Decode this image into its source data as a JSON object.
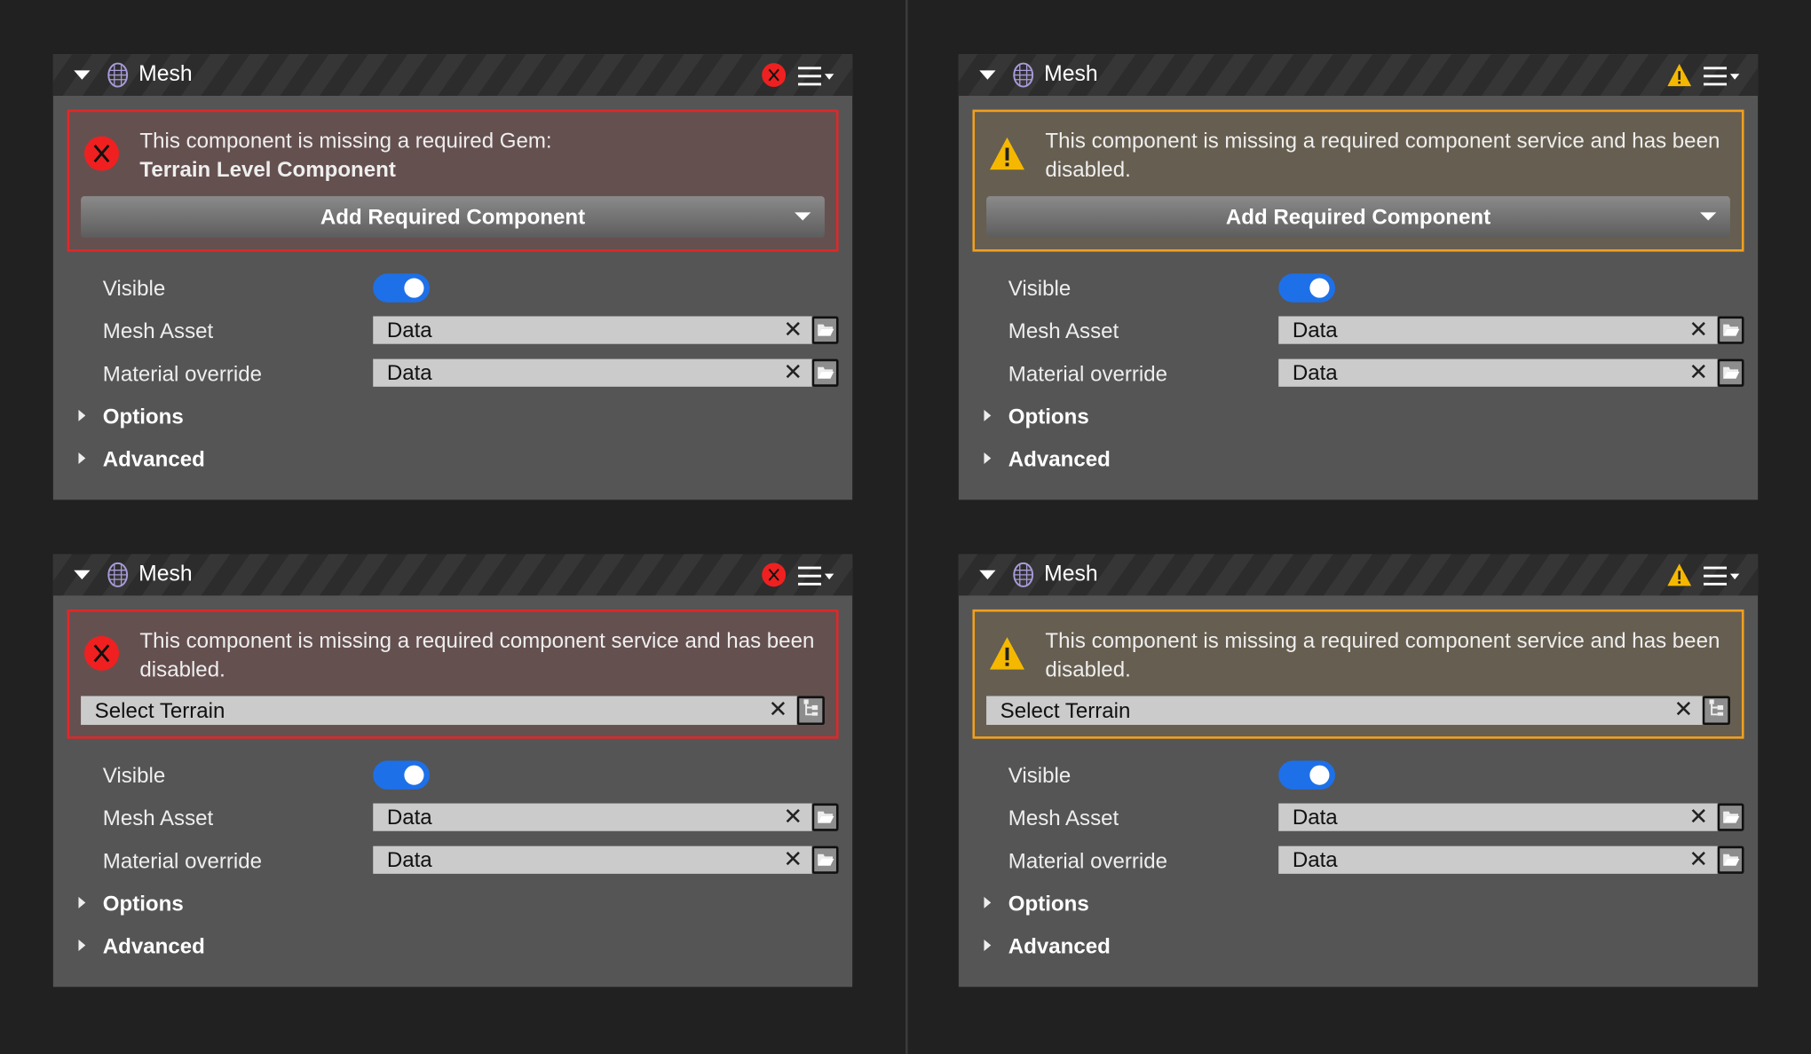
{
  "panels": [
    {
      "title": "Mesh",
      "severity": "error",
      "message": "This component is missing a required Gem:",
      "message_bold": "Terrain Level Component",
      "action": "button",
      "action_label": "Add Required Component",
      "visible_label": "Visible",
      "visible_on": true,
      "mesh_asset_label": "Mesh Asset",
      "mesh_asset_value": "Data",
      "material_label": "Material override",
      "material_value": "Data",
      "options_label": "Options",
      "advanced_label": "Advanced"
    },
    {
      "title": "Mesh",
      "severity": "warning",
      "message": "This component is missing a required component service and has been disabled.",
      "message_bold": null,
      "action": "button",
      "action_label": "Add Required Component",
      "visible_label": "Visible",
      "visible_on": true,
      "mesh_asset_label": "Mesh Asset",
      "mesh_asset_value": "Data",
      "material_label": "Material override",
      "material_value": "Data",
      "options_label": "Options",
      "advanced_label": "Advanced"
    },
    {
      "title": "Mesh",
      "severity": "error",
      "message": "This component is missing a required component service and has been disabled.",
      "message_bold": null,
      "action": "select",
      "action_label": "Select Terrain",
      "visible_label": "Visible",
      "visible_on": true,
      "mesh_asset_label": "Mesh Asset",
      "mesh_asset_value": "Data",
      "material_label": "Material override",
      "material_value": "Data",
      "options_label": "Options",
      "advanced_label": "Advanced"
    },
    {
      "title": "Mesh",
      "severity": "warning",
      "message": "This component is missing a required component service and has been disabled.",
      "message_bold": null,
      "action": "select",
      "action_label": "Select Terrain",
      "visible_label": "Visible",
      "visible_on": true,
      "mesh_asset_label": "Mesh Asset",
      "mesh_asset_value": "Data",
      "material_label": "Material override",
      "material_value": "Data",
      "options_label": "Options",
      "advanced_label": "Advanced"
    }
  ],
  "colors": {
    "error": "#e02828",
    "warning": "#f0a020",
    "toggle": "#1e70e8"
  }
}
